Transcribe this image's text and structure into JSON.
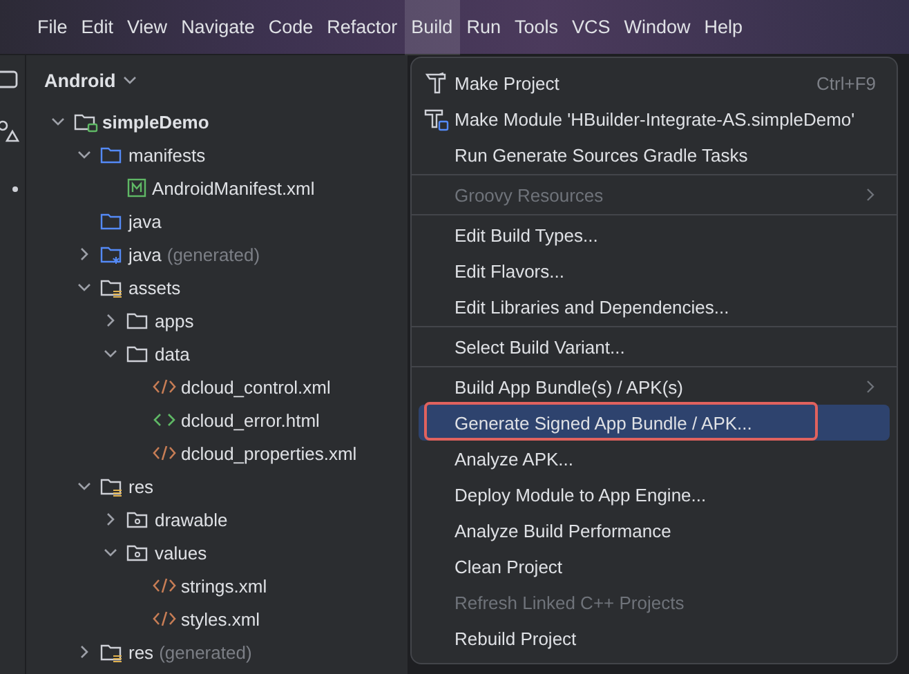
{
  "menubar": [
    {
      "label": "File",
      "selected": false
    },
    {
      "label": "Edit",
      "selected": false
    },
    {
      "label": "View",
      "selected": false
    },
    {
      "label": "Navigate",
      "selected": false
    },
    {
      "label": "Code",
      "selected": false
    },
    {
      "label": "Refactor",
      "selected": false
    },
    {
      "label": "Build",
      "selected": true
    },
    {
      "label": "Run",
      "selected": false
    },
    {
      "label": "Tools",
      "selected": false
    },
    {
      "label": "VCS",
      "selected": false
    },
    {
      "label": "Window",
      "selected": false
    },
    {
      "label": "Help",
      "selected": false
    }
  ],
  "project_panel": {
    "view": "Android",
    "tree": [
      {
        "label": "simpleDemo",
        "kind": "module",
        "expanded": true,
        "children": [
          {
            "label": "manifests",
            "kind": "folder",
            "expanded": true,
            "children": [
              {
                "label": "AndroidManifest.xml",
                "kind": "manifest"
              }
            ]
          },
          {
            "label": "java",
            "kind": "folder"
          },
          {
            "label": "java",
            "note": "(generated)",
            "kind": "generated",
            "expanded": false
          },
          {
            "label": "assets",
            "kind": "resources",
            "expanded": true,
            "children": [
              {
                "label": "apps",
                "kind": "plain",
                "expanded": false
              },
              {
                "label": "data",
                "kind": "plain",
                "expanded": true,
                "children": [
                  {
                    "label": "dcloud_control.xml",
                    "kind": "xml"
                  },
                  {
                    "label": "dcloud_error.html",
                    "kind": "html"
                  },
                  {
                    "label": "dcloud_properties.xml",
                    "kind": "xml"
                  }
                ]
              }
            ]
          },
          {
            "label": "res",
            "kind": "resources",
            "expanded": true,
            "children": [
              {
                "label": "drawable",
                "kind": "package",
                "expanded": false
              },
              {
                "label": "values",
                "kind": "package",
                "expanded": true,
                "children": [
                  {
                    "label": "strings.xml",
                    "kind": "xml"
                  },
                  {
                    "label": "styles.xml",
                    "kind": "xml"
                  }
                ]
              }
            ]
          },
          {
            "label": "res",
            "note": "(generated)",
            "kind": "resources",
            "expanded": false
          }
        ]
      }
    ]
  },
  "build_menu": [
    {
      "kind": "build",
      "label": "Make Project",
      "shortcut": "Ctrl+F9",
      "disabled": false,
      "submenu": false,
      "selected": false
    },
    {
      "kind": "module",
      "label": "Make Module 'HBuilder-Integrate-AS.simpleDemo'",
      "disabled": false,
      "submenu": false,
      "selected": false
    },
    {
      "kind": "plain",
      "label": "Run Generate Sources Gradle Tasks",
      "disabled": false,
      "submenu": false,
      "selected": false
    },
    {
      "kind": "separator"
    },
    {
      "kind": "plain",
      "label": "Groovy Resources",
      "disabled": true,
      "submenu": true,
      "selected": false
    },
    {
      "kind": "separator"
    },
    {
      "kind": "plain",
      "label": "Edit Build Types...",
      "disabled": false,
      "submenu": false,
      "selected": false
    },
    {
      "kind": "plain",
      "label": "Edit Flavors...",
      "disabled": false,
      "submenu": false,
      "selected": false
    },
    {
      "kind": "plain",
      "label": "Edit Libraries and Dependencies...",
      "disabled": false,
      "submenu": false,
      "selected": false
    },
    {
      "kind": "separator"
    },
    {
      "kind": "plain",
      "label": "Select Build Variant...",
      "disabled": false,
      "submenu": false,
      "selected": false
    },
    {
      "kind": "separator"
    },
    {
      "kind": "plain",
      "label": "Build App Bundle(s) / APK(s)",
      "disabled": false,
      "submenu": true,
      "selected": false
    },
    {
      "kind": "plain",
      "label": "Generate Signed App Bundle / APK...",
      "disabled": false,
      "submenu": false,
      "selected": true,
      "outlined": true
    },
    {
      "kind": "plain",
      "label": "Analyze APK...",
      "disabled": false,
      "submenu": false,
      "selected": false
    },
    {
      "kind": "plain",
      "label": "Deploy Module to App Engine...",
      "disabled": false,
      "submenu": false,
      "selected": false
    },
    {
      "kind": "plain",
      "label": "Analyze Build Performance",
      "disabled": false,
      "submenu": false,
      "selected": false
    },
    {
      "kind": "plain",
      "label": "Clean Project",
      "disabled": false,
      "submenu": false,
      "selected": false
    },
    {
      "kind": "plain",
      "label": "Refresh Linked C++ Projects",
      "disabled": true,
      "submenu": false,
      "selected": false
    },
    {
      "kind": "plain",
      "label": "Rebuild Project",
      "disabled": false,
      "submenu": false,
      "selected": false
    }
  ]
}
